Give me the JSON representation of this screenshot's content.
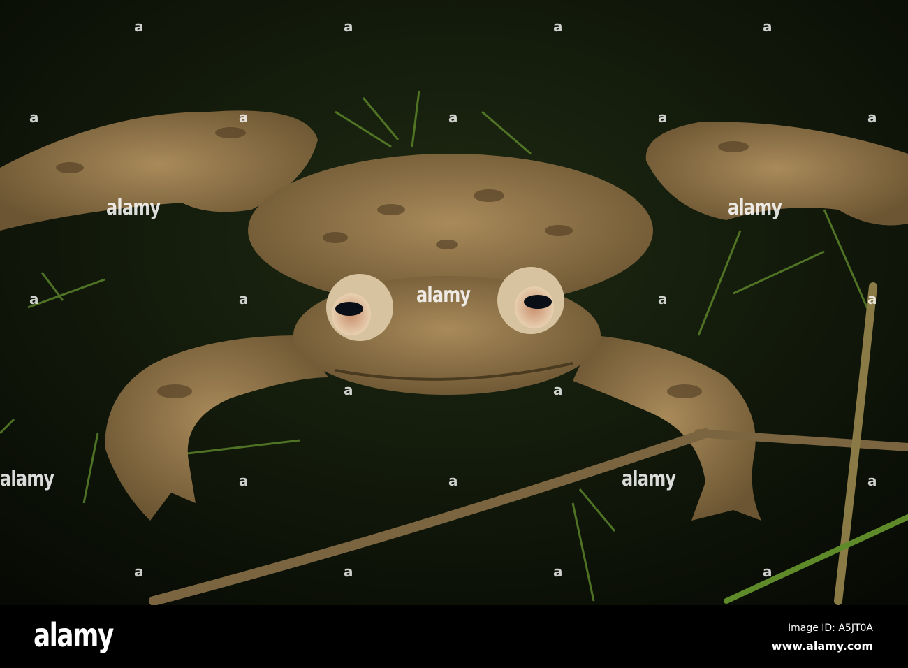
{
  "photo": {
    "subject": "toad",
    "colors": {
      "water": "#10180a",
      "skin": "#8a6f45",
      "skin_dark": "#4e3b22",
      "weed": "#5f8a2a"
    }
  },
  "watermark": {
    "text": "alamy",
    "mark": "a"
  },
  "footer": {
    "logo": "alamy",
    "image_id": "Image ID: A5JT0A",
    "site": "www.alamy.com"
  }
}
